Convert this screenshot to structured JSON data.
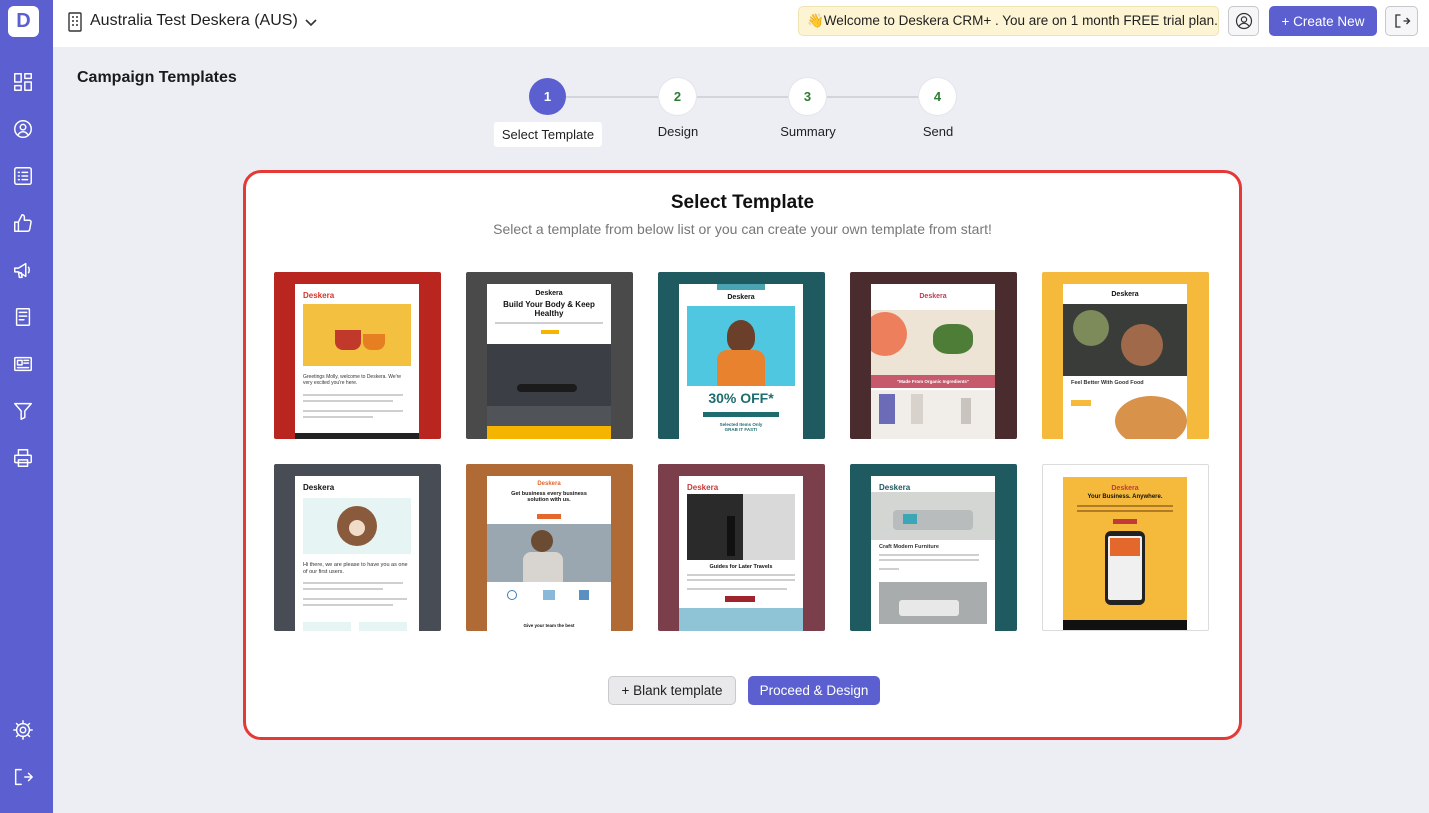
{
  "app": {
    "logo_letter": "D"
  },
  "header": {
    "org_name": "Australia Test Deskera (AUS)",
    "trial_message": "👋Welcome to Deskera CRM+ . You are on 1 month FREE trial plan.",
    "create_new_label": "+ Create New"
  },
  "sidebar": {
    "items": [
      {
        "icon": "dashboard-icon"
      },
      {
        "icon": "contacts-icon"
      },
      {
        "icon": "list-icon"
      },
      {
        "icon": "thumbs-up-icon"
      },
      {
        "icon": "megaphone-icon"
      },
      {
        "icon": "document-icon"
      },
      {
        "icon": "newsletter-icon"
      },
      {
        "icon": "funnel-icon"
      },
      {
        "icon": "printer-icon"
      },
      {
        "icon": "settings-icon"
      },
      {
        "icon": "logout-icon"
      }
    ]
  },
  "page": {
    "title": "Campaign Templates"
  },
  "stepper": {
    "steps": [
      {
        "number": "1",
        "label": "Select Template",
        "active": true
      },
      {
        "number": "2",
        "label": "Design",
        "active": false
      },
      {
        "number": "3",
        "label": "Summary",
        "active": false
      },
      {
        "number": "4",
        "label": "Send",
        "active": false
      }
    ]
  },
  "card": {
    "title": "Select Template",
    "subtitle": "Select a template from below list or you can create your own template from start!",
    "blank_button": "+ Blank template",
    "proceed_button": "Proceed & Design"
  },
  "templates": [
    {
      "bg": "#b8261f",
      "brand": "Deskera",
      "brand_color": "#d2362b",
      "headline": "",
      "text": "Greetings Molly, welcome to Deskera. We're very excited you're here."
    },
    {
      "bg": "#4a4a4a",
      "brand": "Deskera",
      "brand_color": "#111111",
      "headline": "Build Your Body & Keep Healthy",
      "text": ""
    },
    {
      "bg": "#1f5a60",
      "brand": "Deskera",
      "brand_color": "#111111",
      "headline": "30% OFF*",
      "text": "Selected Items Only GRAB IT FAST!"
    },
    {
      "bg": "#4a2b2e",
      "brand": "Deskera",
      "brand_color": "#c23b55",
      "headline": "\"Made From Organic Ingredients\"",
      "text": ""
    },
    {
      "bg": "#f5b93c",
      "brand": "Deskera",
      "brand_color": "#111111",
      "headline": "Feel Better With Good Food",
      "text": ""
    },
    {
      "bg": "#474c55",
      "brand": "Deskera",
      "brand_color": "#111111",
      "headline": "",
      "text": "Hi there, we are please to have you as one of our first users."
    },
    {
      "bg": "#b06a35",
      "brand": "Deskera",
      "brand_color": "#e4672c",
      "headline": "Get business every business solution with us.",
      "text": "Give your team the best"
    },
    {
      "bg": "#7a3f4a",
      "brand": "Deskera",
      "brand_color": "#c23b3b",
      "headline": "Guides for Later Travels",
      "text": ""
    },
    {
      "bg": "#1f5a60",
      "brand": "Deskera",
      "brand_color": "#1f5a60",
      "headline": "Craft Modern Furniture",
      "text": ""
    },
    {
      "bg": "#ffffff",
      "brand": "Deskera",
      "brand_color": "#c23b3b",
      "headline": "Your Business. Anywhere.",
      "text": ""
    }
  ]
}
